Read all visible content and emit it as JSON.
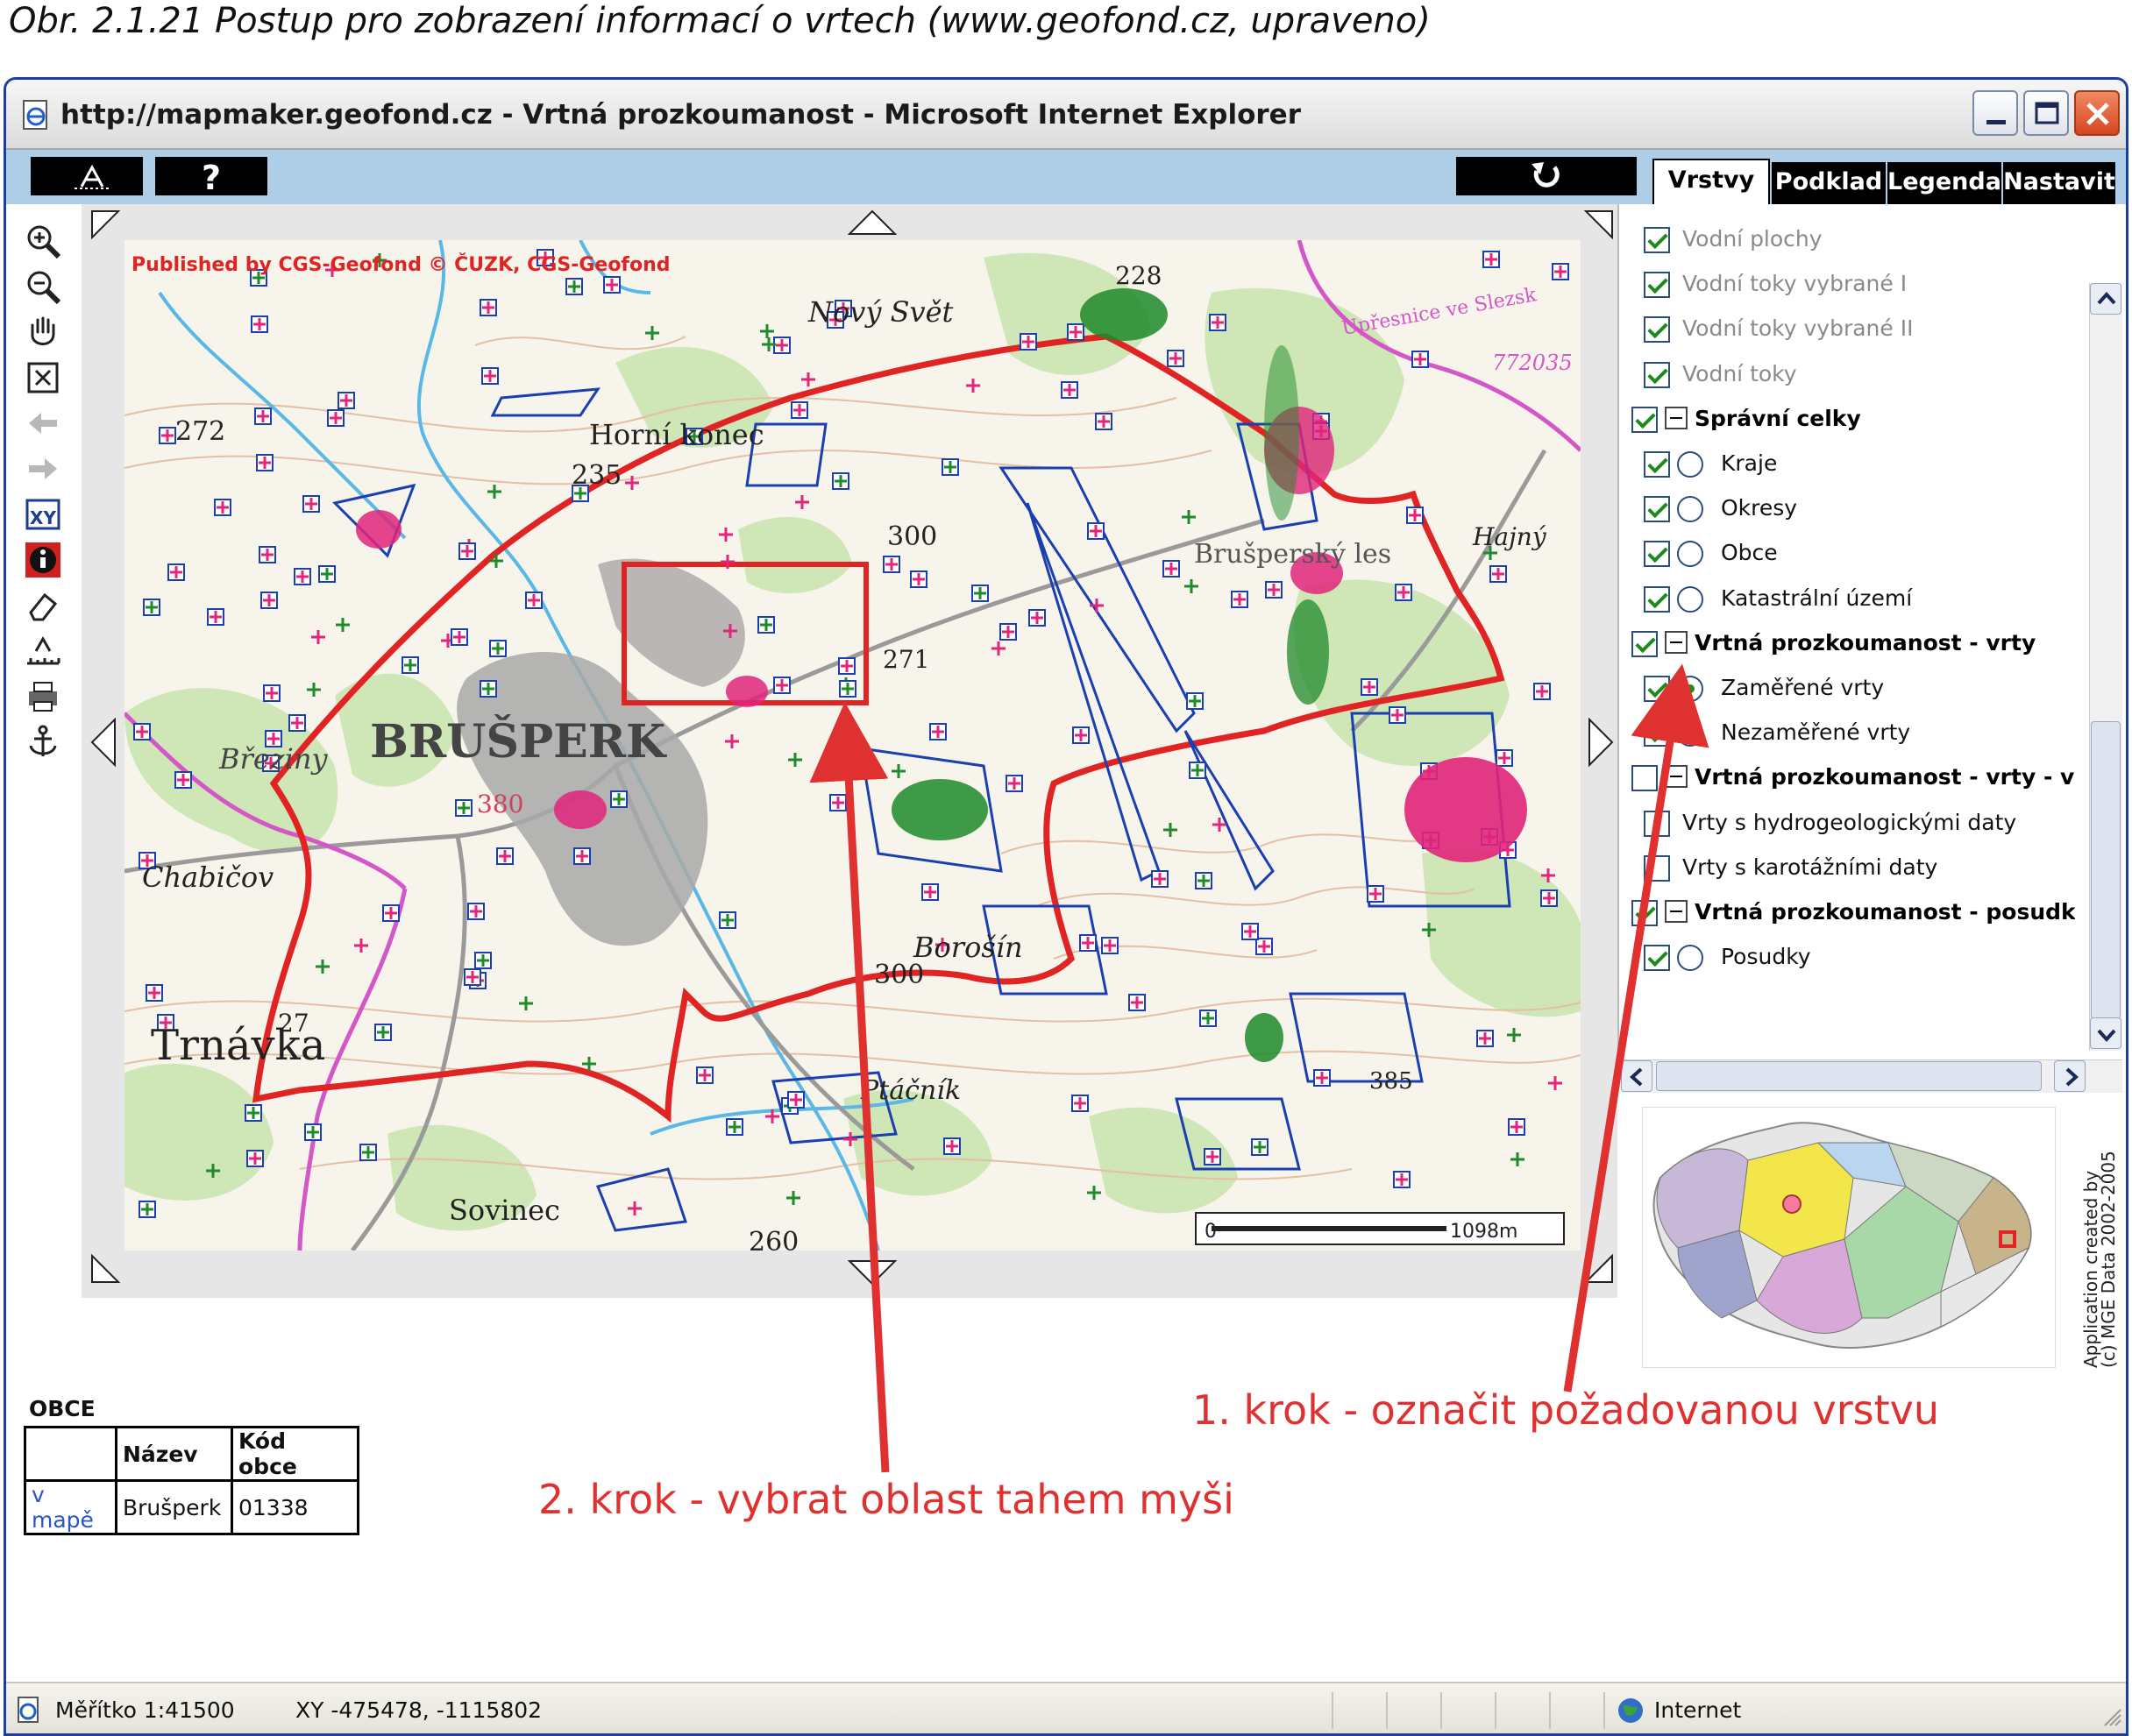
{
  "caption": "Obr. 2.1.21 Postup pro zobrazení informací o vrtech (www.geofond.cz, upraveno)",
  "window": {
    "title": "http://mapmaker.geofond.cz - Vrtná prozkoumanost - Microsoft Internet Explorer"
  },
  "toolbar": {
    "help_label": "?"
  },
  "tabs": [
    "Vrstvy",
    "Podklad",
    "Legenda",
    "Nastavit"
  ],
  "left_tools": [
    "zoom-in-icon",
    "zoom-out-icon",
    "pan-hand-icon",
    "zoom-extent-icon",
    "back-arrow-icon",
    "forward-arrow-icon",
    "xy-coordinates-icon",
    "info-icon",
    "eraser-icon",
    "measure-icon",
    "print-icon",
    "anchor-icon"
  ],
  "map": {
    "publisher_text": "Published by CGS-Geofond   © ČUZK, CGS-Geofond",
    "scalebar_start": "0",
    "scalebar_end": "1098m",
    "labels": {
      "town": "BRUŠPERK",
      "brezi": "Březiny",
      "chabicov": "Chabičov",
      "trnavka": "Trnávka",
      "horni_konec": "Horní konec",
      "novy_svet": "Nový Svět",
      "borosin": "Borošín",
      "sovinec": "Sovinec",
      "placnik": "Ptáčník",
      "hajny": "Hajný",
      "bruspersky": "Brušperský les",
      "prof": "Upřesnice ve Slezsk",
      "e228": "228",
      "e272": "272",
      "e235": "235",
      "e300a": "300",
      "e300b": "300",
      "e271": "271",
      "e380": "380",
      "e260": "260",
      "e27": "27",
      "e385": "385",
      "e72035": "772035"
    }
  },
  "layers": [
    {
      "label": "Vodní plochy",
      "checked": true,
      "style": "grey",
      "indent": 1,
      "radio": null
    },
    {
      "label": "Vodní toky vybrané I",
      "checked": true,
      "style": "grey",
      "indent": 1,
      "radio": null
    },
    {
      "label": "Vodní toky vybrané II",
      "checked": true,
      "style": "grey",
      "indent": 1,
      "radio": null
    },
    {
      "label": "Vodní toky",
      "checked": true,
      "style": "grey",
      "indent": 1,
      "radio": null
    },
    {
      "label": "Správní celky",
      "checked": true,
      "style": "bold",
      "indent": 0,
      "radio": null,
      "group": true
    },
    {
      "label": "Kraje",
      "checked": true,
      "style": "normal",
      "indent": 1,
      "radio": "off"
    },
    {
      "label": "Okresy",
      "checked": true,
      "style": "normal",
      "indent": 1,
      "radio": "off"
    },
    {
      "label": "Obce",
      "checked": true,
      "style": "normal",
      "indent": 1,
      "radio": "off"
    },
    {
      "label": "Katastrální území",
      "checked": true,
      "style": "normal",
      "indent": 1,
      "radio": "off"
    },
    {
      "label": "Vrtná prozkoumanost - vrty",
      "checked": true,
      "style": "bold",
      "indent": 0,
      "radio": null,
      "group": true
    },
    {
      "label": "Zaměřené vrty",
      "checked": true,
      "style": "normal",
      "indent": 1,
      "radio": "on"
    },
    {
      "label": "Nezaměřené vrty",
      "checked": true,
      "style": "normal",
      "indent": 1,
      "radio": "off"
    },
    {
      "label": "Vrtná prozkoumanost - vrty - vý",
      "checked": false,
      "style": "bold",
      "indent": 0,
      "radio": null,
      "group": true
    },
    {
      "label": "Vrty s hydrogeologickými daty",
      "checked": false,
      "style": "normal",
      "indent": 1,
      "radio": null
    },
    {
      "label": "Vrty s karotážními daty",
      "checked": false,
      "style": "normal",
      "indent": 1,
      "radio": null
    },
    {
      "label": "Vrtná prozkoumanost - posudk",
      "checked": true,
      "style": "bold",
      "indent": 0,
      "radio": null,
      "group": true
    },
    {
      "label": "Posudky",
      "checked": true,
      "style": "normal",
      "indent": 1,
      "radio": "off"
    }
  ],
  "overview_credit": "Application created by\n(c) MGE Data 2002-2005",
  "obce": {
    "title": "OBCE",
    "headers": [
      "",
      "Název",
      "Kód obce"
    ],
    "rows": [
      [
        "v mapě",
        "Brušperk",
        "01338"
      ]
    ]
  },
  "annotations": {
    "step1": "1. krok - označit požadovanou vrstvu",
    "step2": "2. krok -  vybrat oblast tahem myši"
  },
  "status": {
    "scale": "Měřítko 1:41500",
    "xy": "XY -475478, -1115802",
    "zone": "Internet"
  },
  "colors": {
    "accent_red": "#e03131",
    "drill_pink": "#e0257a",
    "drill_green": "#1f8a2a",
    "toolbar_blue": "#aecde6"
  }
}
